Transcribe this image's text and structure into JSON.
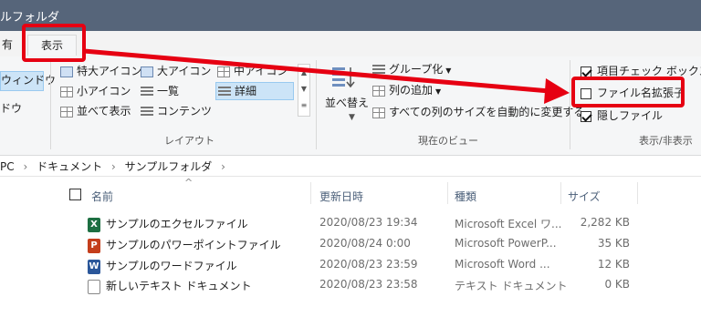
{
  "window": {
    "title": "ルフォルダ"
  },
  "tabs": {
    "share": "有",
    "view": "表示"
  },
  "ribbon": {
    "pane": {
      "nav_window": "ウィンドウ",
      "detail_window": "ドウ"
    },
    "layout": {
      "items": [
        "特大アイコン",
        "大アイコン",
        "中アイコン",
        "小アイコン",
        "一覧",
        "詳細",
        "並べて表示",
        "コンテンツ"
      ],
      "group_label": "レイアウト"
    },
    "current_view": {
      "sort": "並べ替え",
      "group_by": "グループ化",
      "add_columns": "列の追加",
      "fit_columns": "すべての列のサイズを自動的に変更する",
      "group_label": "現在のビュー"
    },
    "show_hide": {
      "item_checkboxes": "項目チェック ボックス",
      "item_checkboxes_checked": true,
      "file_extensions": "ファイル名拡張子",
      "file_extensions_checked": false,
      "hidden_items": "隠しファイル",
      "hidden_items_checked": true,
      "group_label": "表示/非表示"
    }
  },
  "breadcrumb": {
    "items": [
      "PC",
      "ドキュメント",
      "サンプルフォルダ"
    ]
  },
  "columns": {
    "name": "名前",
    "modified": "更新日時",
    "type": "種類",
    "size": "サイズ"
  },
  "files": [
    {
      "name": "サンプルのエクセルファイル",
      "modified": "2020/08/23 19:34",
      "type": "Microsoft Excel ワ...",
      "size": "2,282 KB",
      "icon": "excel-icon",
      "badge": "X",
      "color": "#1d6f42"
    },
    {
      "name": "サンプルのパワーポイントファイル",
      "modified": "2020/08/24 0:00",
      "type": "Microsoft PowerP...",
      "size": "35 KB",
      "icon": "powerpoint-icon",
      "badge": "P",
      "color": "#c43e1c"
    },
    {
      "name": "サンプルのワードファイル",
      "modified": "2020/08/23 23:59",
      "type": "Microsoft Word ...",
      "size": "12 KB",
      "icon": "word-icon",
      "badge": "W",
      "color": "#2b579a"
    },
    {
      "name": "新しいテキスト ドキュメント",
      "modified": "2020/08/23 23:58",
      "type": "テキスト ドキュメント",
      "size": "0 KB",
      "icon": "text-file-icon",
      "badge": "",
      "color": "#ffffff"
    }
  ],
  "annotation": {
    "color": "#e60012"
  }
}
